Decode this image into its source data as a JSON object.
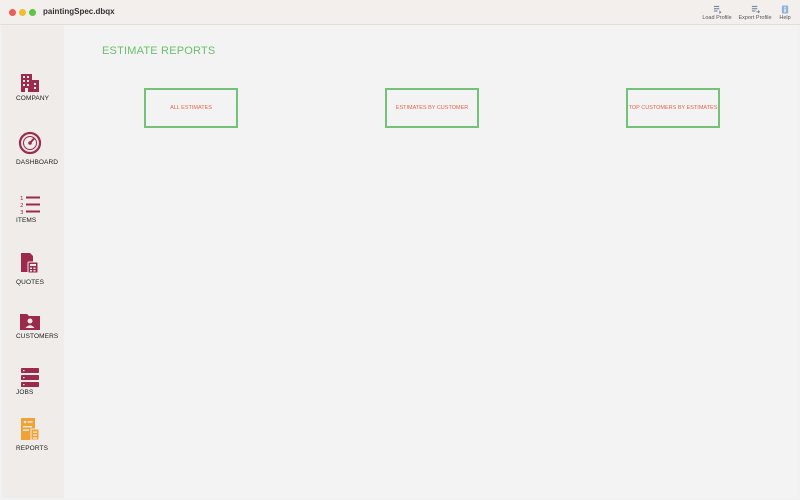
{
  "window": {
    "title": "paintingSpec.dbqx"
  },
  "toolbar": {
    "load_profile": "Load Profile",
    "export_profile": "Export Profile",
    "help": "Help"
  },
  "sidebar": {
    "items": [
      {
        "label": "COMPANY",
        "icon": "building-icon"
      },
      {
        "label": "DASHBOARD",
        "icon": "speedometer-icon"
      },
      {
        "label": "ITEMS",
        "icon": "numbered-list-icon"
      },
      {
        "label": "QUOTES",
        "icon": "quote-document-icon"
      },
      {
        "label": "CUSTOMERS",
        "icon": "customer-folder-icon"
      },
      {
        "label": "JOBS",
        "icon": "stacked-list-icon"
      },
      {
        "label": "REPORTS",
        "icon": "report-document-icon"
      }
    ]
  },
  "main": {
    "title": "ESTIMATE REPORTS",
    "buttons": [
      {
        "label": "ALL ESTIMATES"
      },
      {
        "label": "ESTIMATES BY CUSTOMER"
      },
      {
        "label": "TOP CUSTOMERS BY ESTIMATES"
      }
    ]
  },
  "colors": {
    "nav_icon": "#9c2a4a",
    "active_icon": "#f0a234",
    "title_green": "#6bbf6e",
    "button_border": "#74c277",
    "button_text": "#e9634a"
  }
}
